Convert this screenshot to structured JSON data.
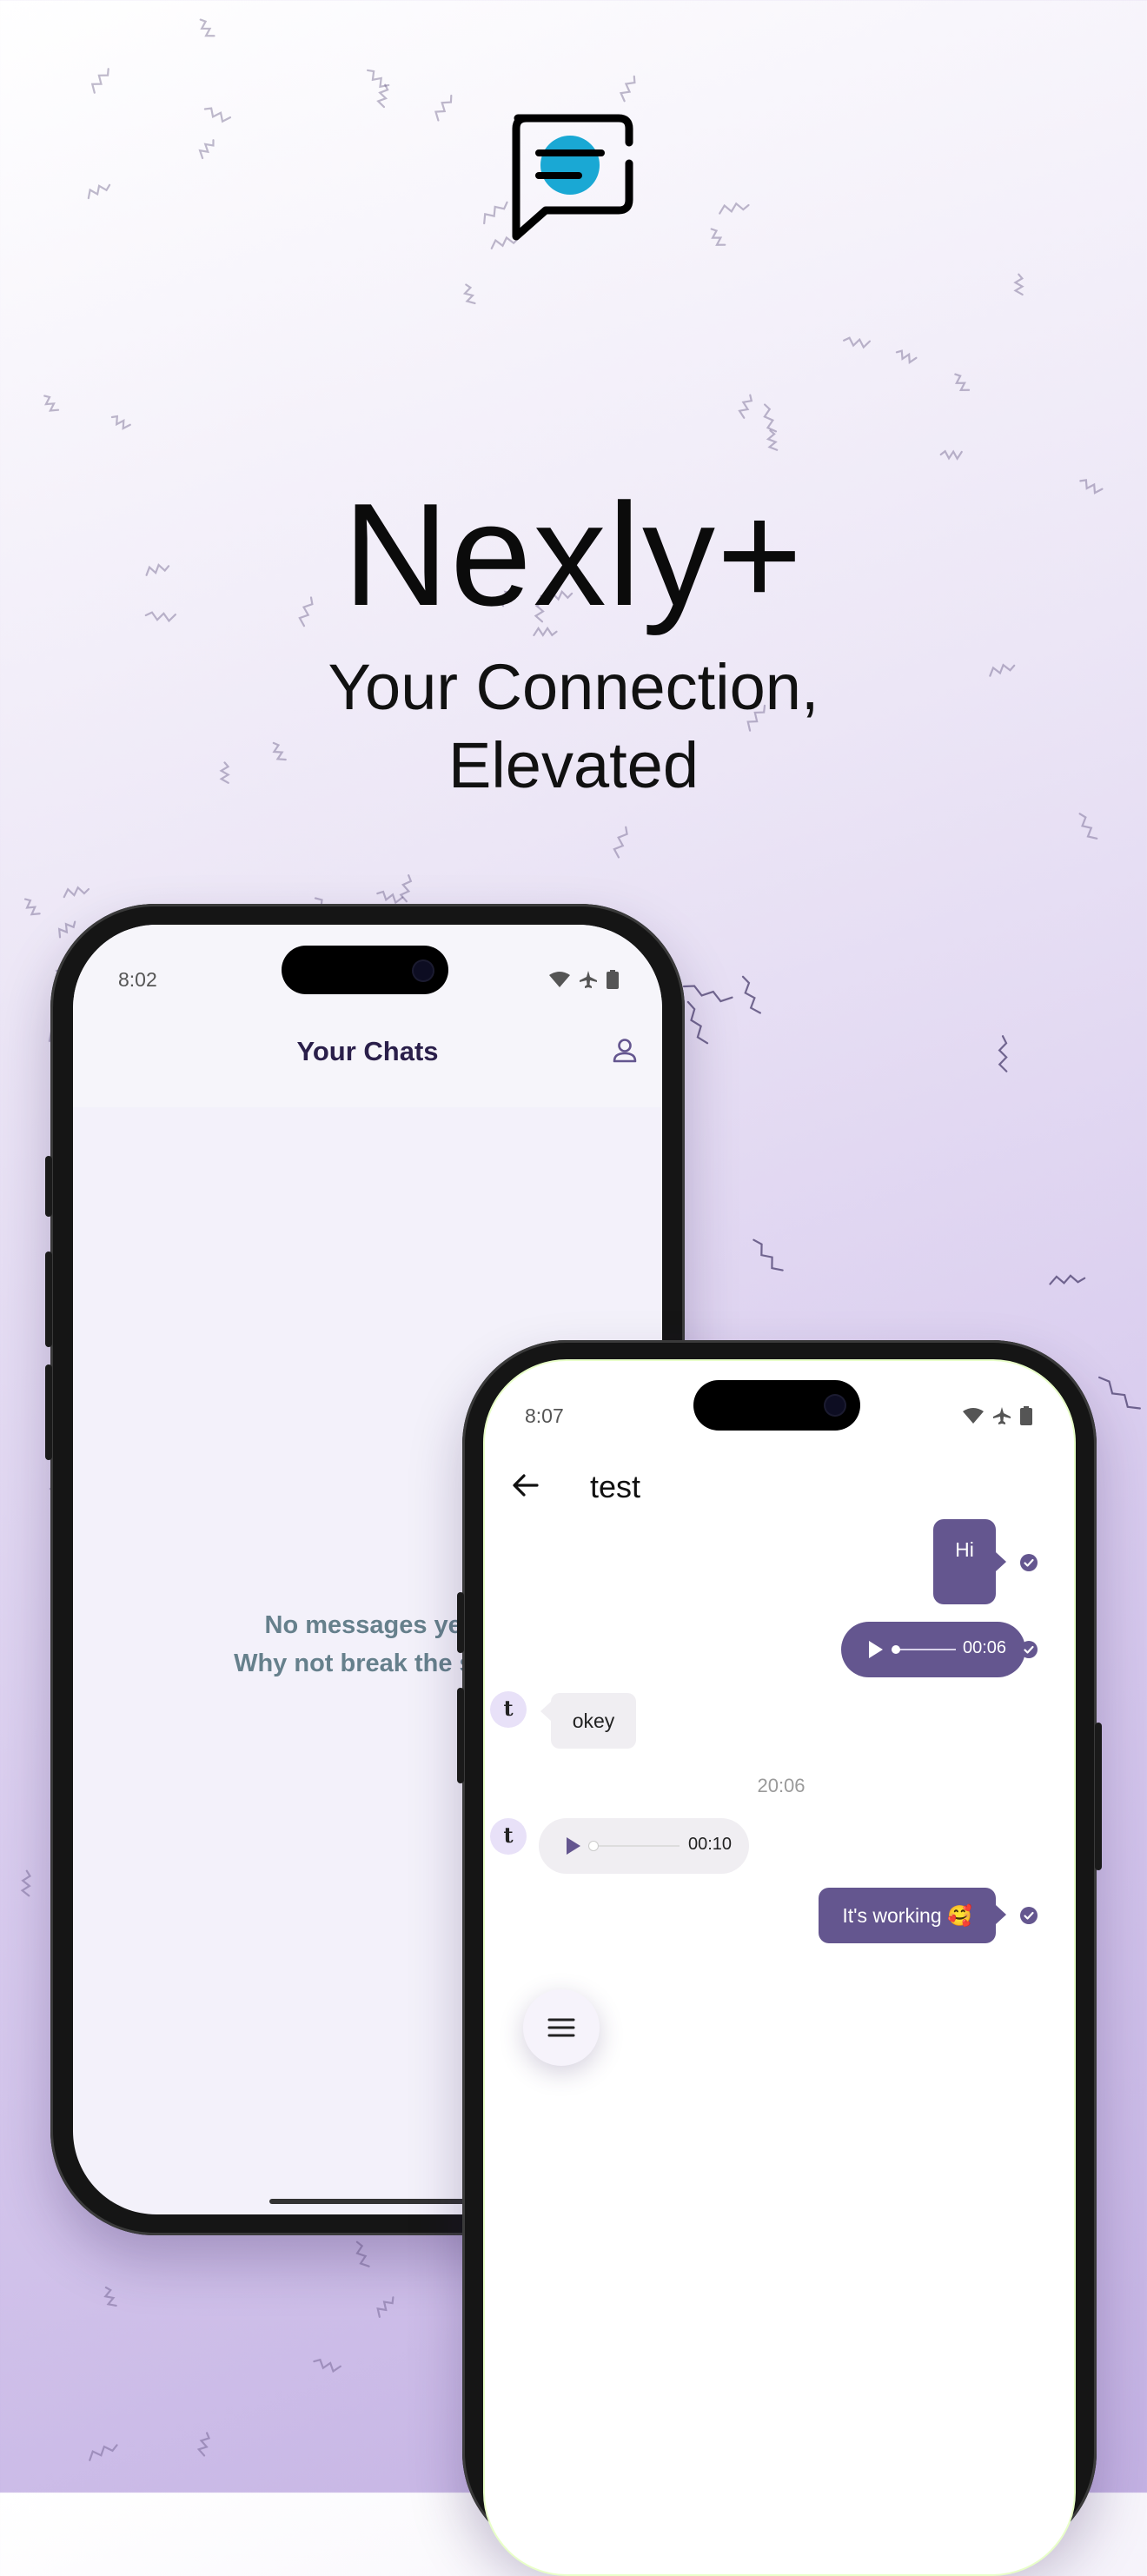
{
  "hero": {
    "title": "Nexly+",
    "subtitle_line1": "Your Connection,",
    "subtitle_line2": "Elevated",
    "logo_icon": "chat-bubble-logo",
    "colors": {
      "logo_dot": "#1aa8d4",
      "accent": "#64568f"
    }
  },
  "phone_chats": {
    "status_time": "8:02",
    "header_title": "Your Chats",
    "profile_icon": "person-icon",
    "empty_line1": "No messages yet",
    "empty_line2": "Why not break the sile"
  },
  "phone_conversation": {
    "status_time": "8:07",
    "back_icon": "arrow-back-icon",
    "contact_name": "test",
    "messages": [
      {
        "direction": "out",
        "type": "text",
        "text": "Hi"
      },
      {
        "direction": "out",
        "type": "audio",
        "duration": "00:06"
      },
      {
        "direction": "in",
        "type": "text",
        "avatar": "t",
        "text": "okey"
      },
      {
        "type": "timestamp",
        "text": "20:06"
      },
      {
        "direction": "in",
        "type": "audio",
        "avatar": "t",
        "duration": "00:10"
      },
      {
        "direction": "out",
        "type": "text",
        "text": "It's working 🥰"
      }
    ],
    "menu_icon": "menu-icon"
  }
}
